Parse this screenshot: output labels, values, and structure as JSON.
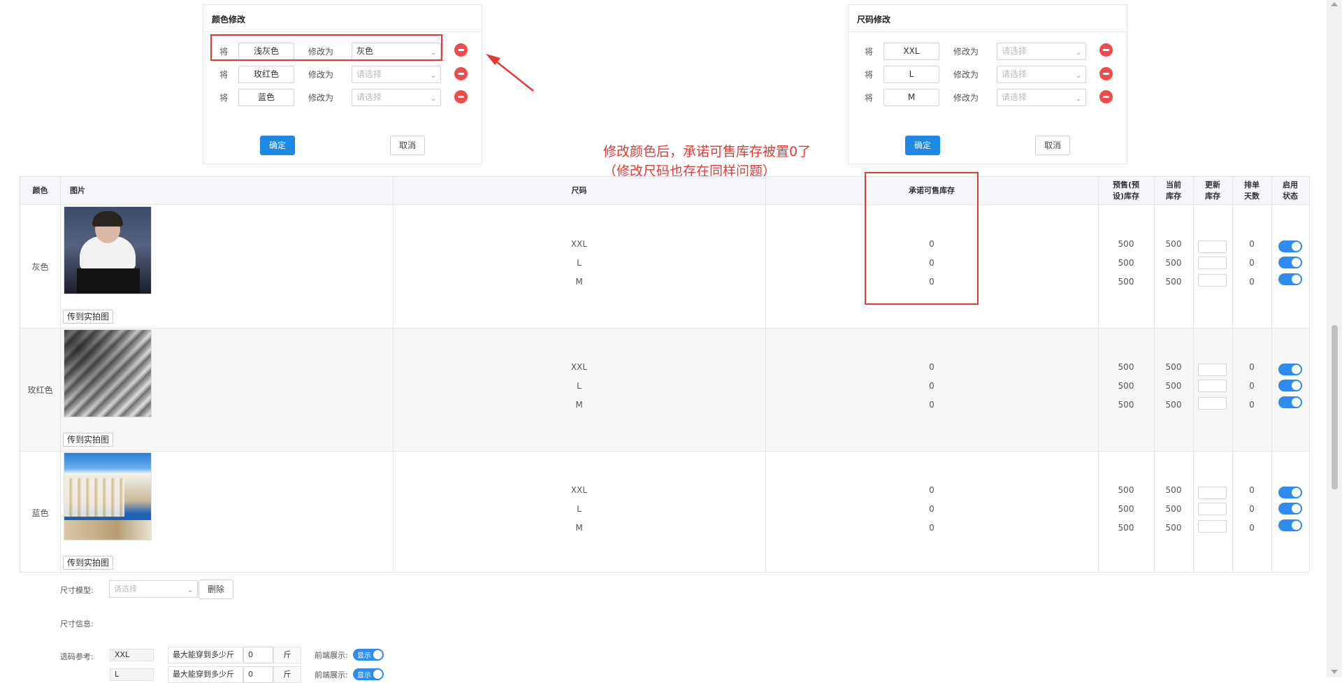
{
  "color_panel": {
    "title": "颜色修改",
    "rows": [
      {
        "prefix": "将",
        "from": "浅灰色",
        "mid": "修改为",
        "to": "灰色",
        "placeholder": ""
      },
      {
        "prefix": "将",
        "from": "玫红色",
        "mid": "修改为",
        "to": "",
        "placeholder": "请选择"
      },
      {
        "prefix": "将",
        "from": "蓝色",
        "mid": "修改为",
        "to": "",
        "placeholder": "请选择"
      }
    ],
    "confirm": "确定",
    "cancel": "取消"
  },
  "size_panel": {
    "title": "尺码修改",
    "rows": [
      {
        "prefix": "将",
        "from": "XXL",
        "mid": "修改为",
        "placeholder": "请选择"
      },
      {
        "prefix": "将",
        "from": "L",
        "mid": "修改为",
        "placeholder": "请选择"
      },
      {
        "prefix": "将",
        "from": "M",
        "mid": "修改为",
        "placeholder": "请选择"
      }
    ],
    "confirm": "确定",
    "cancel": "取消"
  },
  "annotation": {
    "line1": "修改颜色后，承诺可售库存被置0了",
    "line2": "（修改尺码也存在同样问题）",
    "color": "#e53935"
  },
  "table": {
    "headers": {
      "color": "颜色",
      "image": "图片",
      "size": "尺码",
      "promise_stock": "承诺可售库存",
      "presale_stock_1": "预售(预",
      "presale_stock_2": "设)库存",
      "current_stock_1": "当前",
      "current_stock_2": "库存",
      "update_stock_1": "更新",
      "update_stock_2": "库存",
      "queue_days_1": "排单",
      "queue_days_2": "天数",
      "enable_1": "启用",
      "enable_2": "状态"
    },
    "rows": [
      {
        "color": "灰色",
        "upload": "传到实拍图",
        "image": "woman-portrait-photo",
        "sizes": [
          {
            "size": "XXL",
            "promise": "0",
            "presale": "500",
            "current": "500",
            "queue": "0",
            "enabled": true
          },
          {
            "size": "L",
            "promise": "0",
            "presale": "500",
            "current": "500",
            "queue": "0",
            "enabled": true
          },
          {
            "size": "M",
            "promise": "0",
            "presale": "500",
            "current": "500",
            "queue": "0",
            "enabled": true
          }
        ]
      },
      {
        "color": "玫红色",
        "upload": "传到实拍图",
        "image": "architecture-abstract-photo",
        "sizes": [
          {
            "size": "XXL",
            "promise": "0",
            "presale": "500",
            "current": "500",
            "queue": "0",
            "enabled": true
          },
          {
            "size": "L",
            "promise": "0",
            "presale": "500",
            "current": "500",
            "queue": "0",
            "enabled": true
          },
          {
            "size": "M",
            "promise": "0",
            "presale": "500",
            "current": "500",
            "queue": "0",
            "enabled": true
          }
        ]
      },
      {
        "color": "蓝色",
        "upload": "传到实拍图",
        "image": "santorini-coast-photo",
        "sizes": [
          {
            "size": "XXL",
            "promise": "0",
            "presale": "500",
            "current": "500",
            "queue": "0",
            "enabled": true
          },
          {
            "size": "L",
            "promise": "0",
            "presale": "500",
            "current": "500",
            "queue": "0",
            "enabled": true
          },
          {
            "size": "M",
            "promise": "0",
            "presale": "500",
            "current": "500",
            "queue": "0",
            "enabled": true
          }
        ]
      }
    ]
  },
  "bottom": {
    "size_model_label": "尺寸模型:",
    "size_model_placeholder": "请选择",
    "delete": "删除",
    "size_info_label": "尺寸信息:",
    "ref_label": "选码参考:",
    "refs": [
      {
        "size": "XXL",
        "max_label": "最大能穿到多少斤",
        "value": "0",
        "unit": "斤",
        "front_label": "前端展示:",
        "toggle": "显示"
      },
      {
        "size": "L",
        "max_label": "最大能穿到多少斤",
        "value": "0",
        "unit": "斤",
        "front_label": "前端展示:",
        "toggle": "显示"
      }
    ]
  }
}
